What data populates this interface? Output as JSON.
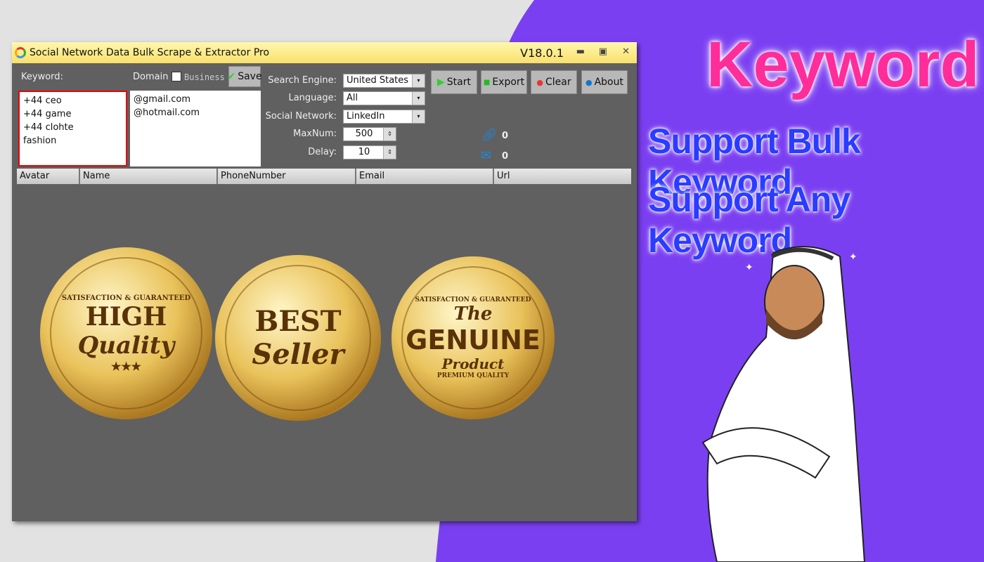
{
  "window": {
    "title": "Social Network Data Bulk Scrape & Extractor Pro",
    "version": "V18.0.1"
  },
  "form": {
    "keyword_label": "Keyword:",
    "domain_label": "Domain",
    "business_label": "Business",
    "business_checked": false,
    "save_label": "Save",
    "keywords": "+44 ceo\n+44 game\n+44 clohte\nfashion",
    "domains": "@gmail.com\n@hotmail.com",
    "search_engine_label": "Search Engine:",
    "search_engine": "United States",
    "language_label": "Language:",
    "language": "All",
    "social_network_label": "Social Network:",
    "social_network": "LinkedIn",
    "maxnum_label": "MaxNum:",
    "maxnum": "500",
    "delay_label": "Delay:",
    "delay": "10"
  },
  "toolbar": {
    "start": "Start",
    "export": "Export",
    "clear": "Clear",
    "about": "About"
  },
  "counters": {
    "links": "0",
    "emails": "0"
  },
  "table": {
    "columns": [
      "Avatar",
      "Name",
      "PhoneNumber",
      "Email",
      "Url"
    ]
  },
  "badges": [
    {
      "top": "SATISFACTION & GUARANTEED",
      "line1": "HIGH",
      "line2": "Quality",
      "bottom": "★★★"
    },
    {
      "line1": "BEST",
      "line2": "Seller"
    },
    {
      "top": "SATISFACTION & GUARANTEED",
      "line0": "The",
      "line1": "GENUINE",
      "line2": "Product",
      "bottom": "PREMIUM QUALITY"
    }
  ],
  "promo": {
    "headline": "Keyword",
    "line1": "Support Bulk Keyword",
    "line2": "Support Any Keyword"
  },
  "colors": {
    "accent_pink": "#ff2d9a",
    "accent_blue": "#2a3cff",
    "purple_bg": "#7b3ff2",
    "titlebar": "#f9e06a"
  }
}
